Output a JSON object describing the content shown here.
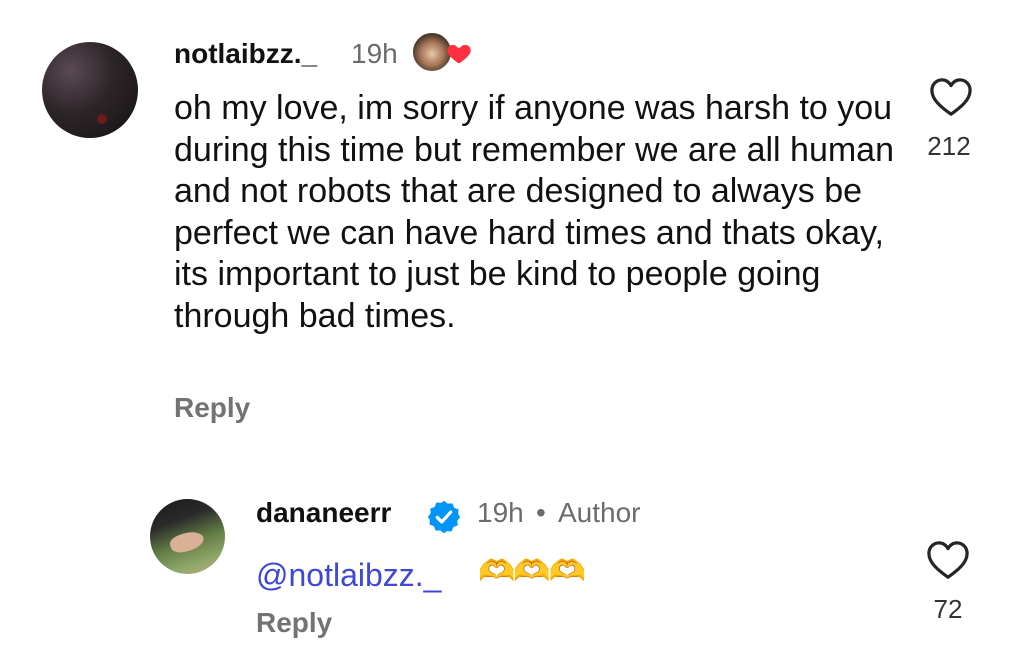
{
  "comments": [
    {
      "username": "notlaibzz._",
      "time": "19h",
      "text": "oh my love, im sorry if anyone was harsh to you during this time but remember we are all human and not robots that are designed to always be perfect we can have hard times and thats okay, its important to just be kind to people going through bad times.",
      "reply_label": "Reply",
      "like_count": "212",
      "reaction": {
        "icon": "heart-icon",
        "color": "#ff3040"
      }
    },
    {
      "username": "dananeerr",
      "time": "19h",
      "separator": "•",
      "badge": "Author",
      "mention": "@notlaibzz._",
      "emojis": "🫶🫶🫶",
      "reply_label": "Reply",
      "like_count": "72",
      "verified_color": "#0095f6"
    }
  ]
}
